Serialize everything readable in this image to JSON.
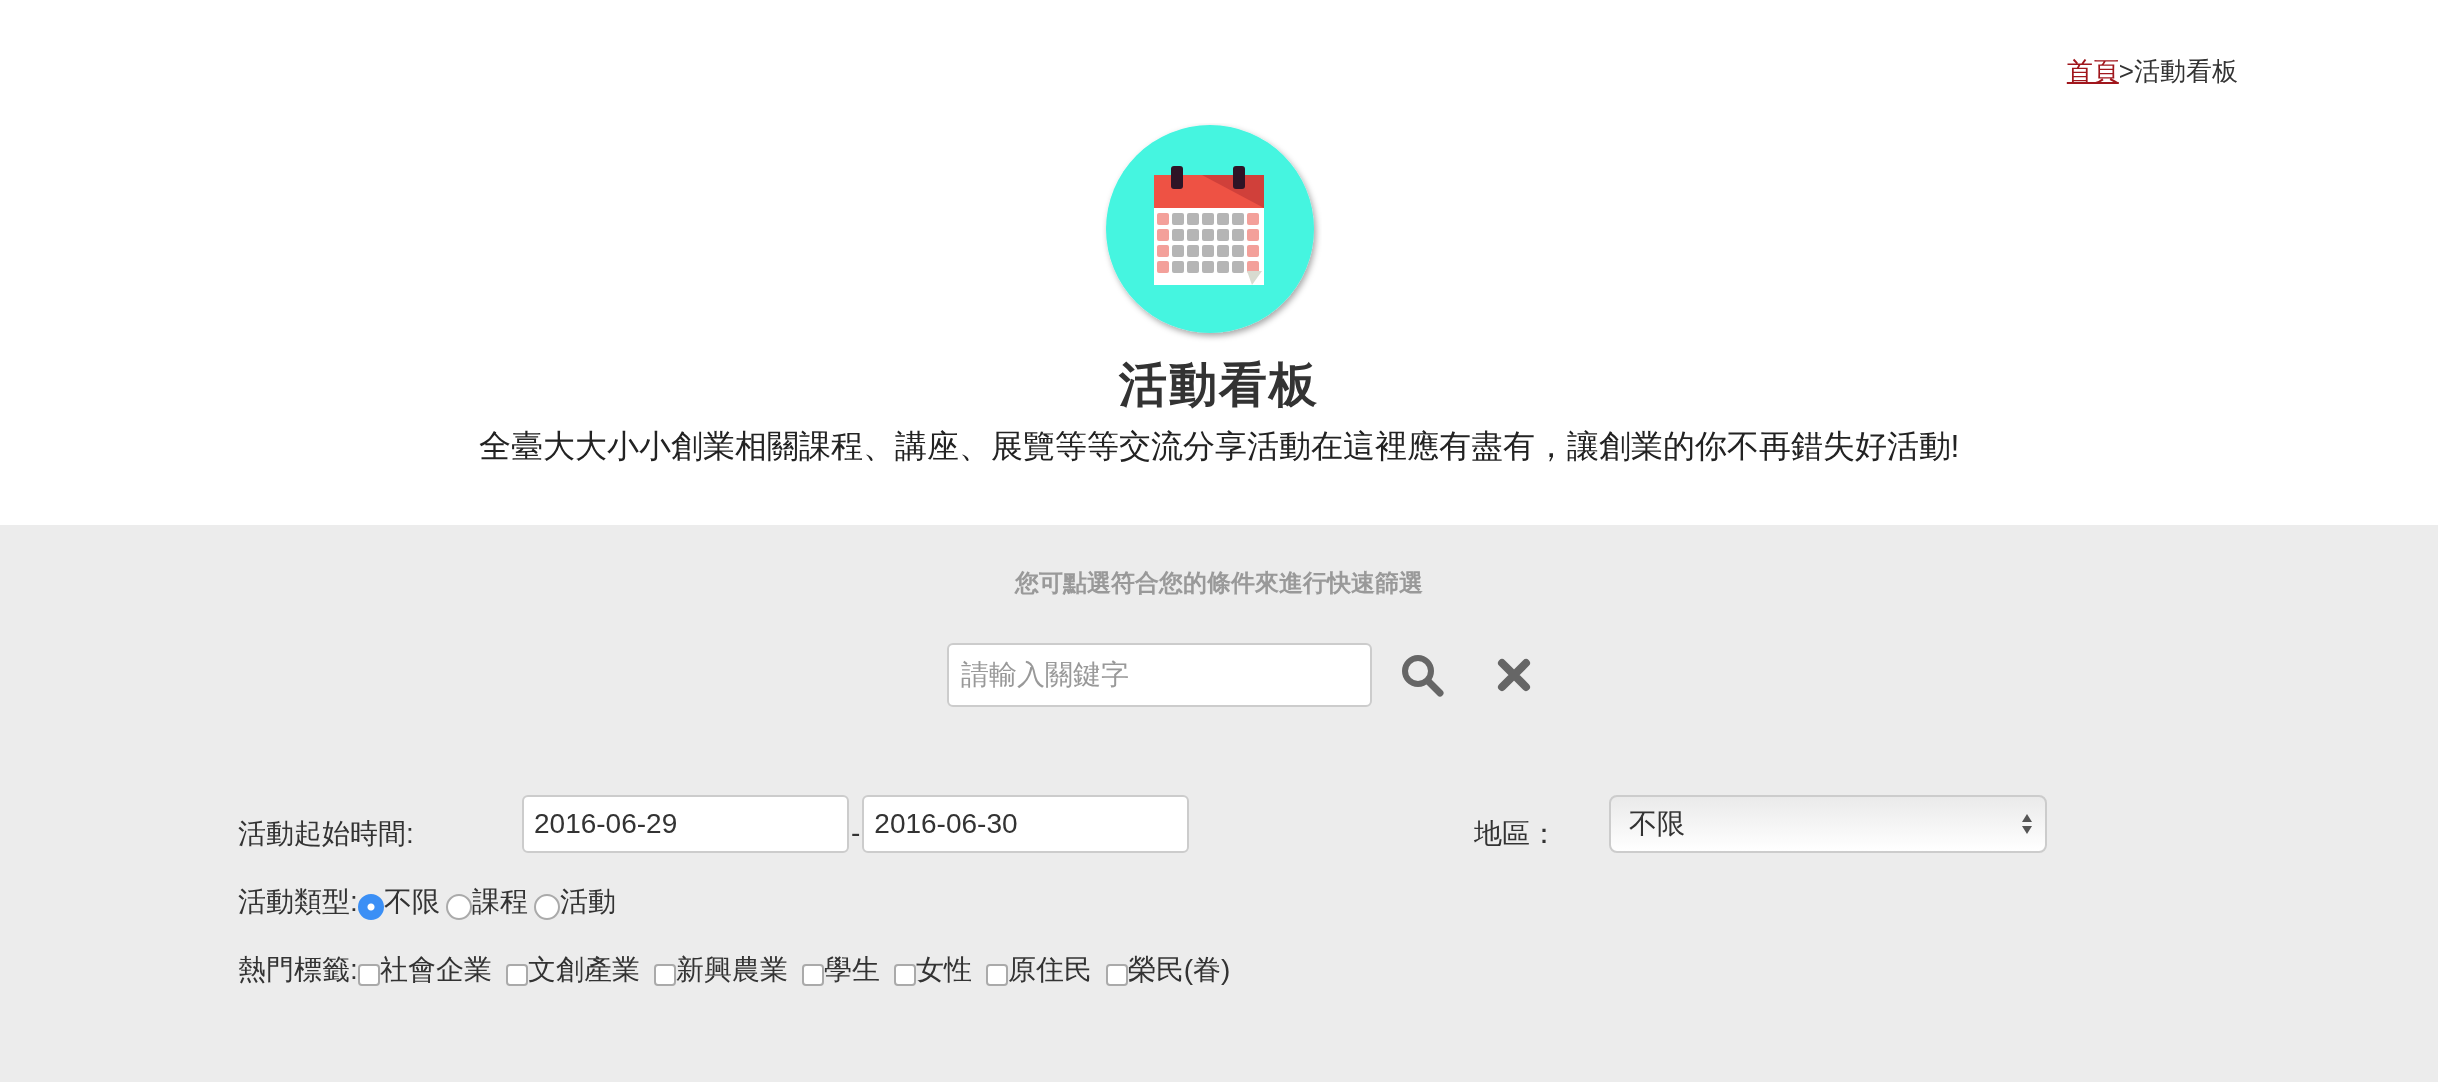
{
  "breadcrumb": {
    "home": "首頁",
    "separator": ">",
    "current": "活動看板"
  },
  "header": {
    "title": "活動看板",
    "subtitle": "全臺大大小小創業相關課程、講座、展覽等等交流分享活動在這裡應有盡有，讓創業的你不再錯失好活動!"
  },
  "filter": {
    "hint": "您可點選符合您的條件來進行快速篩選",
    "search": {
      "placeholder": "請輸入關鍵字"
    },
    "date": {
      "label": "活動起始時間:",
      "start": "2016-06-29",
      "separator": "-",
      "end": "2016-06-30"
    },
    "region": {
      "label": "地區：",
      "value": "不限"
    },
    "type": {
      "label": "活動類型:",
      "options": [
        {
          "label": "不限",
          "selected": true
        },
        {
          "label": "課程",
          "selected": false
        },
        {
          "label": "活動",
          "selected": false
        }
      ]
    },
    "tags": {
      "label": "熱門標籤:",
      "options": [
        {
          "label": "社會企業",
          "checked": false
        },
        {
          "label": "文創產業",
          "checked": false
        },
        {
          "label": "新興農業",
          "checked": false
        },
        {
          "label": "學生",
          "checked": false
        },
        {
          "label": "女性",
          "checked": false
        },
        {
          "label": "原住民",
          "checked": false
        },
        {
          "label": "榮民(眷)",
          "checked": false
        }
      ]
    }
  }
}
